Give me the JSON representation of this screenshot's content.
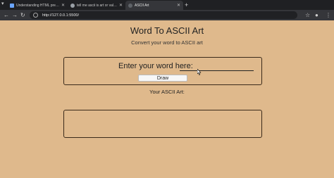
{
  "browser": {
    "tabs": [
      {
        "title": "Understanding HTML pre Tag",
        "icon": "document-icon",
        "active": false
      },
      {
        "title": "tell me ascii is art or value in p...",
        "icon": "globe-icon",
        "active": false
      },
      {
        "title": "ASCII Art",
        "icon": "blank-page-icon",
        "active": true
      }
    ],
    "url": "http://127.0.0.1:5500/"
  },
  "page": {
    "title": "Word To ASCII Art",
    "subtitle": "Convert your word to ASCII art",
    "input_label": "Enter your word here:",
    "input_value": "",
    "draw_button": "Draw",
    "output_label": "Your ASCII Art:",
    "output": ""
  }
}
